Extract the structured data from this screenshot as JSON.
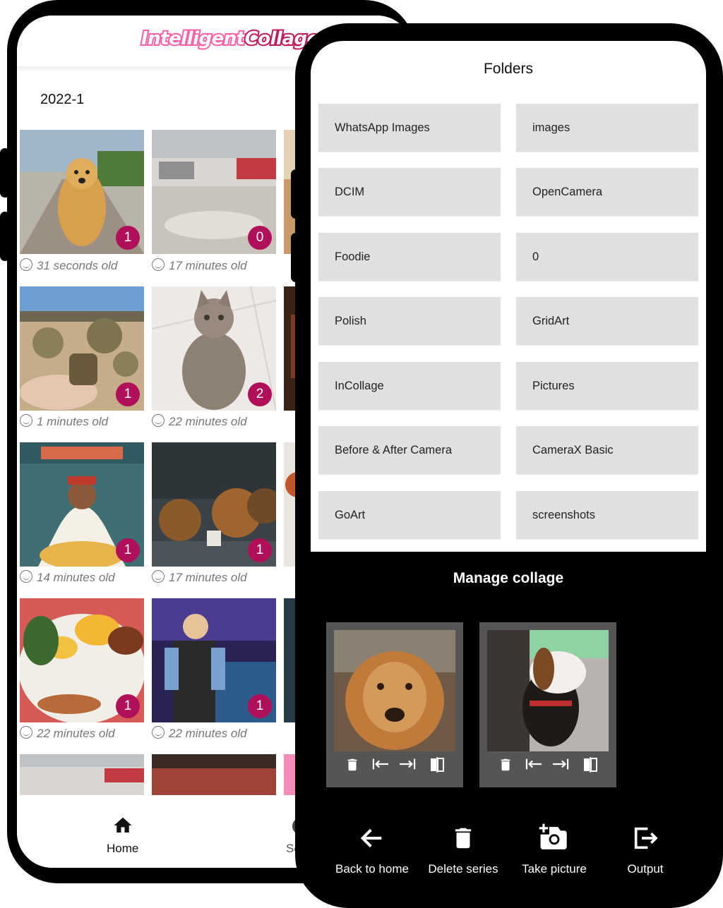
{
  "app": {
    "logo_part1": "Intelligent",
    "logo_part2": "Collage"
  },
  "gallery": {
    "section_title": "2022-1",
    "photos": [
      {
        "badge": "1",
        "age": "31 seconds old"
      },
      {
        "badge": "0",
        "age": "17 minutes old"
      },
      {
        "badge": "1",
        "age": "1 minutes old"
      },
      {
        "badge": "2",
        "age": "22 minutes old"
      },
      {
        "badge": "1",
        "age": "14 minutes old"
      },
      {
        "badge": "1",
        "age": "17 minutes old"
      },
      {
        "badge": "1",
        "age": "22 minutes old"
      },
      {
        "badge": "1",
        "age": "22 minutes old"
      }
    ]
  },
  "bottom_nav": {
    "home_label": "Home",
    "settings_label_partial": "Set"
  },
  "folders": {
    "title": "Folders",
    "items": [
      "WhatsApp Images",
      "images",
      "DCIM",
      "OpenCamera",
      "Foodie",
      "0",
      "Polish",
      "GridArt",
      "InCollage",
      "Pictures",
      "Before & After Camera",
      "CameraX Basic",
      "GoArt",
      "screenshots"
    ]
  },
  "manage": {
    "title": "Manage collage",
    "tool_icons": [
      "trash-icon",
      "move-left-icon",
      "move-right-icon",
      "flip-icon"
    ]
  },
  "actions": {
    "back_label": "Back to home",
    "delete_label": "Delete series",
    "take_label": "Take picture",
    "output_label": "Output"
  },
  "colors": {
    "badge": "#b0105a",
    "folder_bg": "#e0e0e0",
    "logo_pink": "#ff5fa8",
    "logo_magenta": "#c2185b"
  }
}
